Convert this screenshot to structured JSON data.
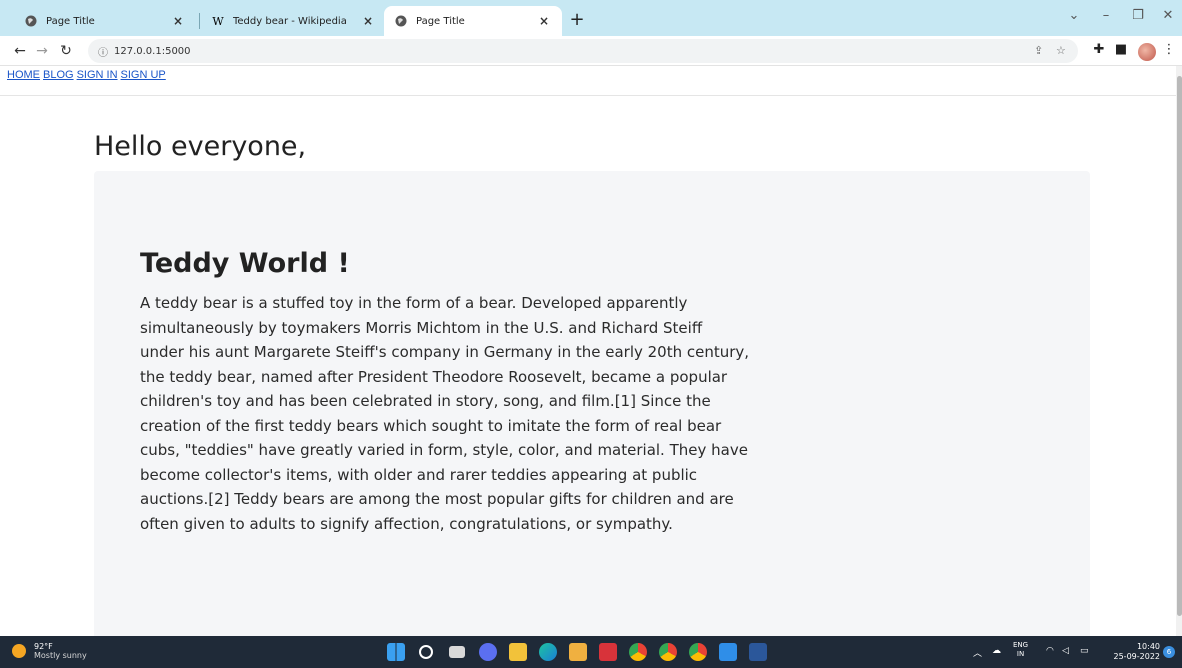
{
  "browser": {
    "tabs": [
      {
        "title": "Page Title",
        "favicon": "globe-icon",
        "active": false
      },
      {
        "title": "Teddy bear - Wikipedia",
        "favicon": "wikipedia-w-icon",
        "active": false
      },
      {
        "title": "Page Title",
        "favicon": "globe-icon",
        "active": true
      }
    ],
    "favicon_wiki_letter": "W",
    "new_tab_label": "+",
    "url": "127.0.0.1:5000",
    "info_icon": "info-icon"
  },
  "page": {
    "nav": [
      {
        "label": "HOME"
      },
      {
        "label": "BLOG"
      },
      {
        "label": "SIGN IN"
      },
      {
        "label": "SIGN UP"
      }
    ],
    "greeting": "Hello everyone,",
    "heading": "Teddy World !",
    "paragraph": "A teddy bear is a stuffed toy in the form of a bear. Developed apparently simultaneously by toymakers Morris Michtom in the U.S. and Richard Steiff under his aunt Margarete Steiff's company in Germany in the early 20th century, the teddy bear, named after President Theodore Roosevelt, became a popular children's toy and has been celebrated in story, song, and film.[1] Since the creation of the first teddy bears which sought to imitate the form of real bear cubs, \"teddies\" have greatly varied in form, style, color, and material. They have become collector's items, with older and rarer teddies appearing at public auctions.[2] Teddy bears are among the most popular gifts for children and are often given to adults to signify affection, congratulations, or sympathy."
  },
  "taskbar": {
    "weather_temp": "92°F",
    "weather_desc": "Mostly sunny",
    "lang_line1": "ENG",
    "lang_line2": "IN",
    "time": "10:40",
    "date": "25-09-2022",
    "notification_count": "6"
  },
  "colors": {
    "tabstrip": "#c7e8f3",
    "link": "#1a55c8",
    "jumbotron": "#f5f6f8",
    "taskbar": "#1f2a38"
  }
}
